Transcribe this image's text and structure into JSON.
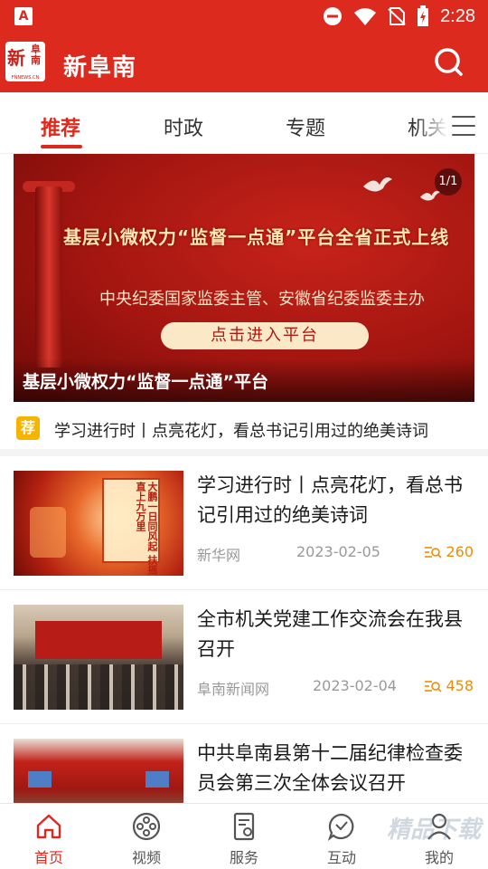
{
  "status_bar": {
    "time": "2:28",
    "left_icon": "app-notification-icon",
    "right_icons": [
      "do-not-disturb-icon",
      "wifi-icon",
      "no-sim-icon",
      "battery-charging-icon"
    ]
  },
  "app_bar": {
    "title": "新阜南",
    "logo": {
      "main": "新",
      "side": "阜南",
      "sub": "FNNEWS.CN"
    },
    "search_icon": "search-icon"
  },
  "tabs": [
    {
      "label": "推荐",
      "active": true
    },
    {
      "label": "时政",
      "active": false
    },
    {
      "label": "专题",
      "active": false
    },
    {
      "label": "机关",
      "active": false
    }
  ],
  "menu_icon": "menu-icon",
  "banner": {
    "headline": "基层小微权力“监督一点通”平台全省正式上线",
    "subtitle": "中央纪委国家监委主管、安徽省纪委监委主办",
    "cta": "点击进入平台",
    "counter": "1/1",
    "caption": "基层小微权力“监督一点通”平台"
  },
  "recommend": {
    "badge": "荐",
    "text": "学习进行时丨点亮花灯，看总书记引用过的绝美诗词"
  },
  "articles": [
    {
      "title": "学习进行时丨点亮花灯，看总书记引用过的绝美诗词",
      "source": "新华网",
      "date": "2023-02-05",
      "views": "260",
      "thumb_text": "大鹏一日同风起 扶摇直上九万里"
    },
    {
      "title": "全市机关党建工作交流会在我县召开",
      "source": "阜南新闻网",
      "date": "2023-02-04",
      "views": "458"
    },
    {
      "title": "中共阜南县第十二届纪律检查委员会第三次全体会议召开"
    }
  ],
  "bottom_nav": [
    {
      "label": "首页",
      "icon": "home-icon",
      "active": true
    },
    {
      "label": "视频",
      "icon": "film-reel-icon",
      "active": false
    },
    {
      "label": "服务",
      "icon": "service-document-icon",
      "active": false
    },
    {
      "label": "互动",
      "icon": "chat-bubble-icon",
      "active": false
    },
    {
      "label": "我的",
      "icon": "user-icon",
      "active": false
    }
  ],
  "watermark": "精品下载",
  "colors": {
    "brand": "#dc2a1e",
    "accent": "#f08c00",
    "badge": "#f6b400"
  }
}
